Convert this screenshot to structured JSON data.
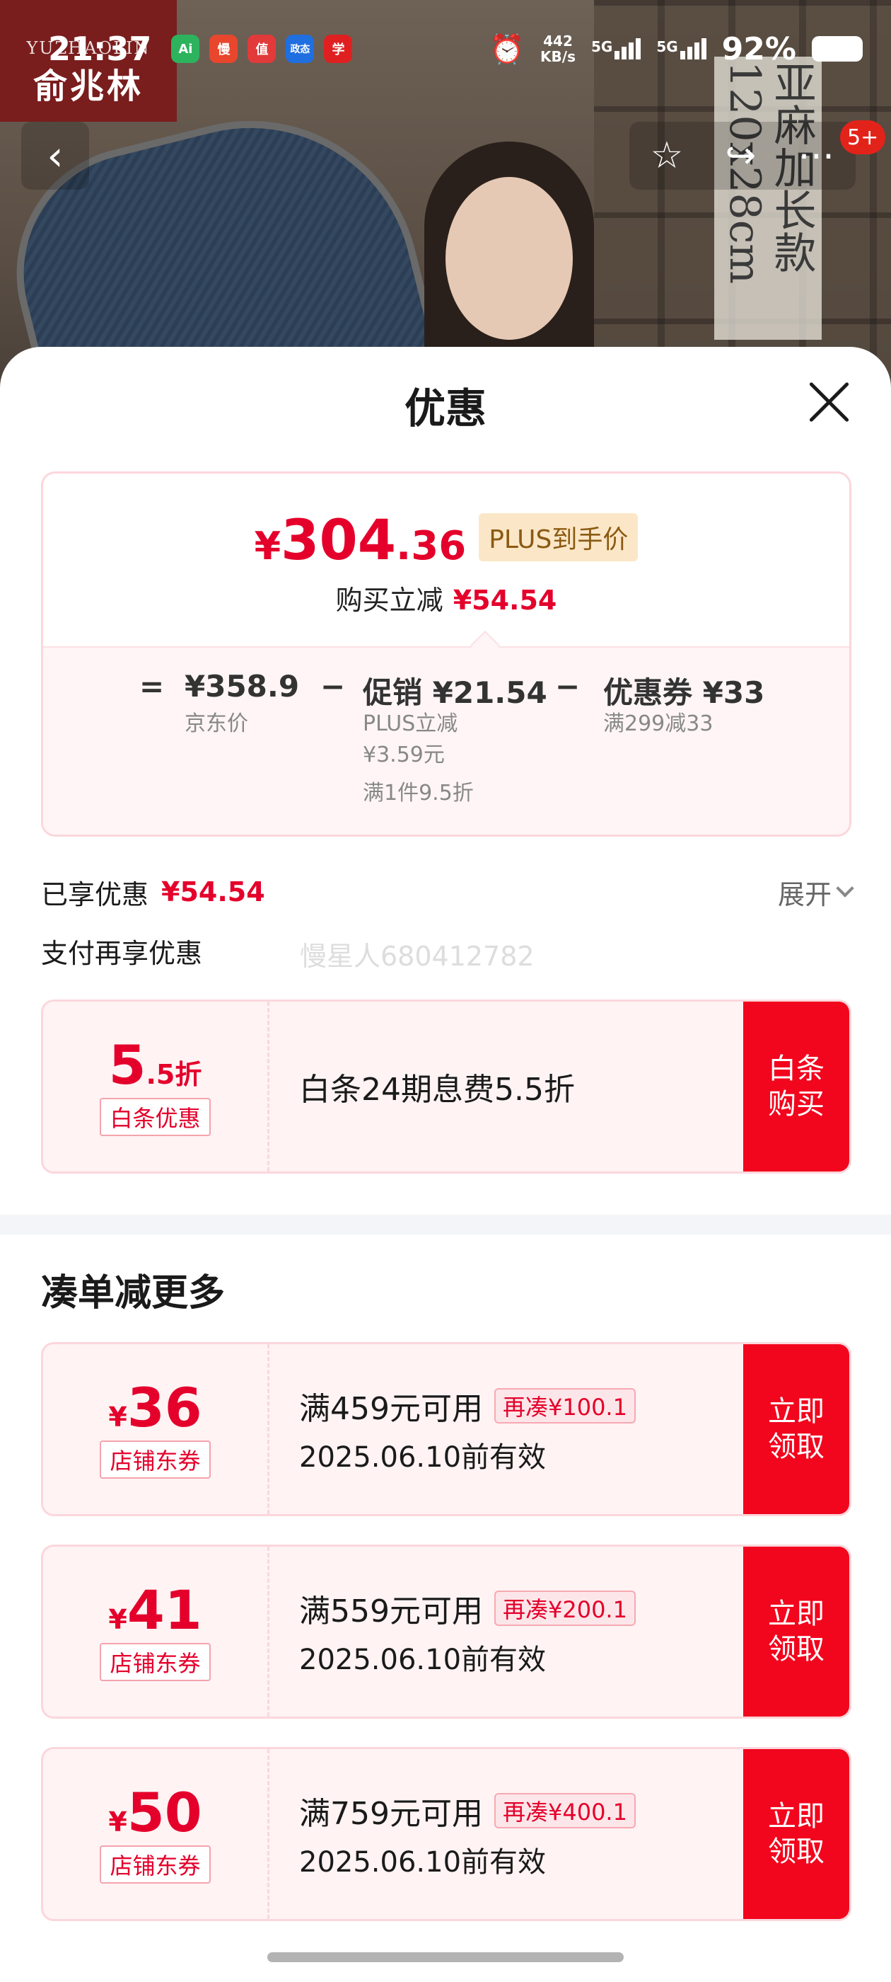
{
  "status_bar": {
    "time": "21:37",
    "net_speed_value": "442",
    "net_speed_unit": "KB/s",
    "network_1": "5G",
    "network_2": "5G",
    "battery": "92%",
    "app_icons": [
      {
        "name": "ai-app-icon",
        "text": "Ai",
        "color": "#2db35d"
      },
      {
        "name": "man-app-icon",
        "text": "慢",
        "color": "#e8462d"
      },
      {
        "name": "zhi-app-icon",
        "text": "值",
        "color": "#e23a3a"
      },
      {
        "name": "zhengwu-app-icon",
        "text": "政态",
        "color": "#1f6fe0"
      },
      {
        "name": "xuexi-app-icon",
        "text": "学",
        "color": "#e02020"
      }
    ]
  },
  "background": {
    "brand_en": "YUZHAOLIN",
    "brand_cn": "俞兆林",
    "vertical_text": "亚麻加长款 120x28cm",
    "notification_count": "5+"
  },
  "sheet": {
    "title": "优惠"
  },
  "price_card": {
    "yen": "¥",
    "price_int": "304",
    "price_dec": ".36",
    "plus_tag": "PLUS到手价",
    "discount_label": "购买立减",
    "discount_value": "¥54.54",
    "formula": {
      "equals": "=",
      "jd_price": "¥358.9",
      "jd_price_label": "京东价",
      "minus_1": "−",
      "promo": "促销 ¥21.54",
      "promo_note_1": "PLUS立减",
      "promo_note_2": "¥3.59元",
      "promo_note_3": "满1件9.5折",
      "minus_2": "−",
      "coupon": "优惠券 ¥33",
      "coupon_note": "满299减33"
    }
  },
  "enjoyed": {
    "label": "已享优惠",
    "value": "¥54.54",
    "expand": "展开"
  },
  "pay_section": {
    "label": "支付再享优惠",
    "watermark": "慢星人680412782",
    "baitiao": {
      "big": "5",
      "small": ".5折",
      "tag": "白条优惠",
      "title": "白条24期息费5.5折",
      "button_1": "白条",
      "button_2": "购买"
    }
  },
  "more_section": {
    "title": "凑单减更多",
    "coupons": [
      {
        "yen": "¥",
        "amount": "36",
        "tag": "店铺东券",
        "title": "满459元可用",
        "chip": "再凑¥100.1",
        "date": "2025.06.10前有效",
        "button_1": "立即",
        "button_2": "领取"
      },
      {
        "yen": "¥",
        "amount": "41",
        "tag": "店铺东券",
        "title": "满559元可用",
        "chip": "再凑¥200.1",
        "date": "2025.06.10前有效",
        "button_1": "立即",
        "button_2": "领取"
      },
      {
        "yen": "¥",
        "amount": "50",
        "tag": "店铺东券",
        "title": "满759元可用",
        "chip": "再凑¥400.1",
        "date": "2025.06.10前有效",
        "button_1": "立即",
        "button_2": "领取"
      }
    ]
  },
  "colors": {
    "accent_red": "#e4002b",
    "button_red": "#f2061d",
    "card_border": "#fbd7dc",
    "plus_gold_bg": "#fbe7c7"
  }
}
